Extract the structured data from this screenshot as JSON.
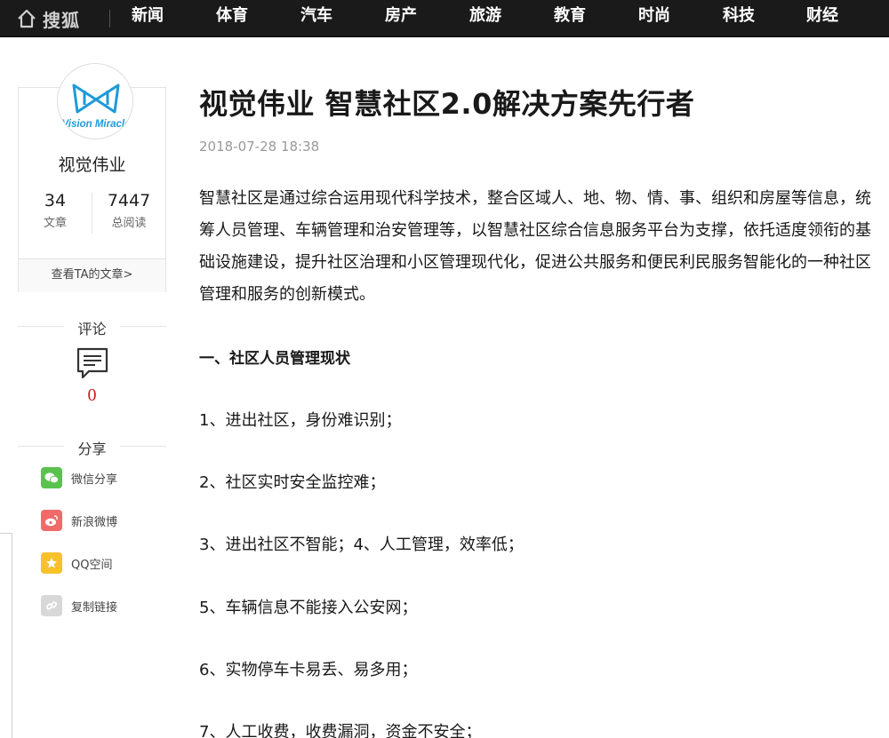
{
  "topnav": {
    "brand": "搜狐",
    "items": [
      "新闻",
      "体育",
      "汽车",
      "房产",
      "旅游",
      "教育",
      "时尚",
      "科技",
      "财经"
    ]
  },
  "author": {
    "logo_text": "Vision Miracle",
    "name": "视觉伟业",
    "articles_count": "34",
    "articles_label": "文章",
    "reads_count": "7447",
    "reads_label": "总阅读",
    "view_articles": "查看TA的文章>"
  },
  "comments": {
    "title": "评论",
    "count": "0"
  },
  "share": {
    "title": "分享",
    "items": [
      {
        "label": "微信分享",
        "color": "#5bc14f",
        "icon": "wechat-icon"
      },
      {
        "label": "新浪微博",
        "color": "#f06a6a",
        "icon": "weibo-icon"
      },
      {
        "label": "QQ空间",
        "color": "#f6c12b",
        "icon": "qzone-icon"
      },
      {
        "label": "复制链接",
        "color": "#d8d8d8",
        "icon": "link-icon"
      }
    ]
  },
  "article": {
    "title": "视觉伟业 智慧社区2.0解决方案先行者",
    "date": "2018-07-28 18:38",
    "intro": "智慧社区是通过综合运用现代科学技术，整合区域人、地、物、情、事、组织和房屋等信息，统筹人员管理、车辆管理和治安管理等，以智慧社区综合信息服务平台为支撑，依托适度领衔的基础设施建设，提升社区治理和小区管理现代化，促进公共服务和便民利民服务智能化的一种社区管理和服务的创新模式。",
    "section_heading": "一、社区人员管理现状",
    "items": [
      "1、进出社区，身份难识别；",
      "2、社区实时安全监控难；",
      "3、进出社区不智能；4、人工管理，效率低；",
      "5、车辆信息不能接入公安网；",
      "6、实物停车卡易丢、易多用；",
      "7、人工收费，收费漏洞，资金不安全；"
    ]
  }
}
